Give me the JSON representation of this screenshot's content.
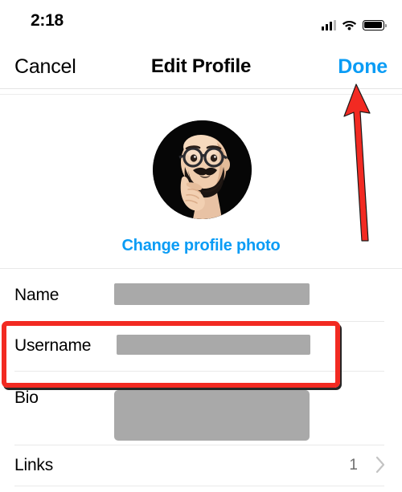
{
  "status_bar": {
    "time": "2:18",
    "signal_icon": "cellular-signal-icon",
    "wifi_icon": "wifi-icon",
    "battery_icon": "battery-icon"
  },
  "nav_bar": {
    "cancel_label": "Cancel",
    "title": "Edit Profile",
    "done_label": "Done",
    "done_color": "#0a9cf5"
  },
  "profile": {
    "avatar_name": "memoji-avatar",
    "change_photo_label": "Change profile photo",
    "change_photo_color": "#0a9cf5"
  },
  "form": {
    "rows": [
      {
        "label": "Name",
        "value": "",
        "redacted": true
      },
      {
        "label": "Username",
        "value": "",
        "redacted": true
      },
      {
        "label": "Bio",
        "value": "",
        "redacted": true
      },
      {
        "label": "Links",
        "value": "1",
        "redacted": false,
        "chevron": "chevron-right-icon"
      }
    ]
  },
  "annotations": {
    "highlight_color": "#f22a22",
    "highlight_target": "username-row",
    "arrow_color": "#f22a22",
    "arrow_target": "done-button"
  }
}
